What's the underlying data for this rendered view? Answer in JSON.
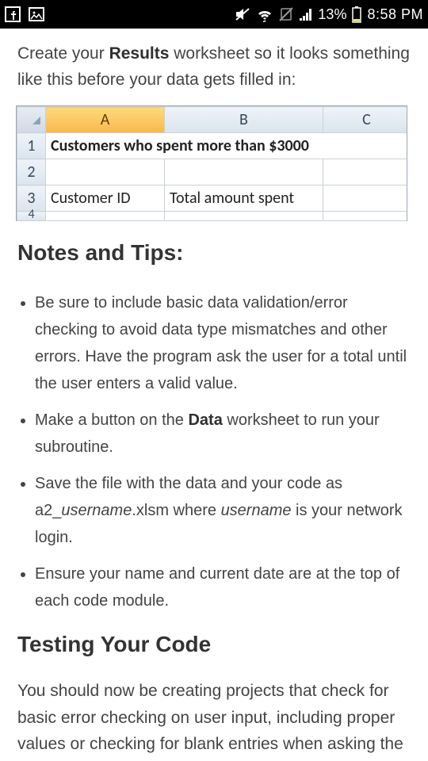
{
  "status": {
    "battery_pct": "13%",
    "time": "8:58 PM"
  },
  "content": {
    "intro_pre": "Create your ",
    "intro_bold": "Results",
    "intro_post": " worksheet so it looks something like this before your data gets filled in:",
    "sheet": {
      "cols": {
        "a": "A",
        "b": "B",
        "c": "C"
      },
      "rows": {
        "r1": "1",
        "r2": "2",
        "r3": "3",
        "r4": "4",
        "a1": "Customers who spent more than $3000",
        "a3": "Customer ID",
        "b3": "Total amount spent"
      }
    },
    "h_notes": "Notes and Tips:",
    "tips": {
      "t1": "Be sure to include basic data validation/error checking to avoid data type mismatches and other errors. Have the program ask the user for a total until the user enters a valid value.",
      "t2_a": "Make a button on the ",
      "t2_b": "Data",
      "t2_c": " worksheet to run your subroutine.",
      "t3_a": "Save the file with the data and your code as a2_",
      "t3_b": "username",
      "t3_c": ".xlsm where ",
      "t3_d": "username",
      "t3_e": " is your network login.",
      "t4": "Ensure your name and current date are at the top of each code module."
    },
    "h_test": "Testing Your Code",
    "outro": "You should now be creating projects that check for basic error checking on user input, including proper values or checking for blank entries when asking the"
  }
}
